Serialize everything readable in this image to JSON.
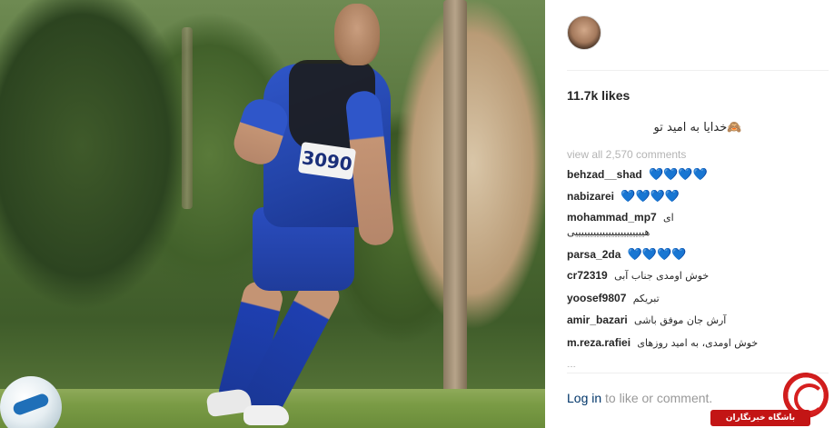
{
  "post": {
    "likes": "11.7k likes",
    "caption": "🙈خدایا به امید تو",
    "view_all": "view all 2,570 comments",
    "photo_number": "3090"
  },
  "comments": [
    {
      "user": "behzad__shad",
      "text": "💙💙💙💙",
      "hearts": true
    },
    {
      "user": "nabizarei",
      "text": "💙💙💙💙",
      "hearts": true
    },
    {
      "user": "mohammad_mp7",
      "text": "ای",
      "line2": "هیییییییییییییییییییییییی"
    },
    {
      "user": "parsa_2da",
      "text": "💙💙💙💙",
      "hearts": true
    },
    {
      "user": "cr72319",
      "text": "خوش اومدی جناب آبی"
    },
    {
      "user": "yoosef9807",
      "text": "تبریکم"
    },
    {
      "user": "amir_bazari",
      "text": "آرش جان موفق باشی"
    },
    {
      "user": "m.reza.rafiei",
      "text": "خوش اومدی، به امید روزهای"
    },
    {
      "user": "...",
      "text": "",
      "fade": true
    }
  ],
  "footer": {
    "login_link": "Log in",
    "login_rest": " to like or comment."
  },
  "watermark": {
    "text": "باشگاه خبرنگاران"
  }
}
